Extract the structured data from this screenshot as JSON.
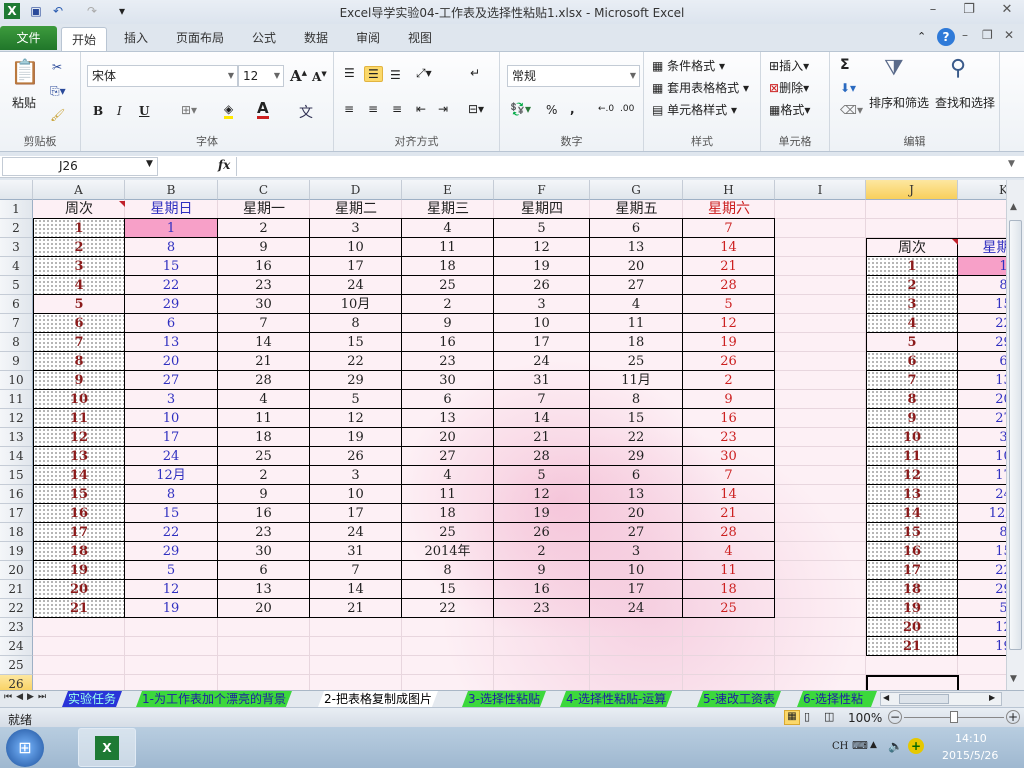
{
  "window": {
    "title": "Excel导学实验04-工作表及选择性粘贴1.xlsx  -  Microsoft Excel"
  },
  "ribbon_tabs": [
    "文件",
    "开始",
    "插入",
    "页面布局",
    "公式",
    "数据",
    "审阅",
    "视图"
  ],
  "ribbon": {
    "clipboard": {
      "label": "剪贴板",
      "paste": "粘贴"
    },
    "font": {
      "label": "字体",
      "name": "宋体",
      "size": "12",
      "bold": "B",
      "italic": "I",
      "underline": "U"
    },
    "alignment": {
      "label": "对齐方式"
    },
    "number": {
      "label": "数字",
      "format": "常规",
      "percent": "%",
      "comma": ","
    },
    "styles": {
      "label": "样式",
      "conditional": "条件格式",
      "table": "套用表格格式",
      "cell": "单元格样式"
    },
    "cells": {
      "label": "单元格",
      "insert": "插入",
      "delete": "删除",
      "format": "格式"
    },
    "editing": {
      "label": "编辑",
      "sum": "Σ",
      "sort": "排序和筛选",
      "find": "查找和选择"
    }
  },
  "formula_bar": {
    "name_box": "J26",
    "fx": "fx",
    "value": ""
  },
  "columns": [
    "A",
    "B",
    "C",
    "D",
    "E",
    "F",
    "G",
    "H",
    "I",
    "J",
    "K"
  ],
  "rows": [
    "1",
    "2",
    "3",
    "4",
    "5",
    "6",
    "7",
    "8",
    "9",
    "10",
    "11",
    "12",
    "13",
    "14",
    "15",
    "16",
    "17",
    "18",
    "19",
    "20",
    "21",
    "22",
    "23",
    "24",
    "25",
    "26"
  ],
  "selected_cell": "J26",
  "table": {
    "headers": [
      "周次",
      "星期日",
      "星期一",
      "星期二",
      "星期三",
      "星期四",
      "星期五",
      "星期六"
    ],
    "rows": [
      [
        "1",
        "1",
        "2",
        "3",
        "4",
        "5",
        "6",
        "7"
      ],
      [
        "2",
        "8",
        "9",
        "10",
        "11",
        "12",
        "13",
        "14"
      ],
      [
        "3",
        "15",
        "16",
        "17",
        "18",
        "19",
        "20",
        "21"
      ],
      [
        "4",
        "22",
        "23",
        "24",
        "25",
        "26",
        "27",
        "28"
      ],
      [
        "5",
        "29",
        "30",
        "10月",
        "2",
        "3",
        "4",
        "5"
      ],
      [
        "6",
        "6",
        "7",
        "8",
        "9",
        "10",
        "11",
        "12"
      ],
      [
        "7",
        "13",
        "14",
        "15",
        "16",
        "17",
        "18",
        "19"
      ],
      [
        "8",
        "20",
        "21",
        "22",
        "23",
        "24",
        "25",
        "26"
      ],
      [
        "9",
        "27",
        "28",
        "29",
        "30",
        "31",
        "11月",
        "2"
      ],
      [
        "10",
        "3",
        "4",
        "5",
        "6",
        "7",
        "8",
        "9"
      ],
      [
        "11",
        "10",
        "11",
        "12",
        "13",
        "14",
        "15",
        "16"
      ],
      [
        "12",
        "17",
        "18",
        "19",
        "20",
        "21",
        "22",
        "23"
      ],
      [
        "13",
        "24",
        "25",
        "26",
        "27",
        "28",
        "29",
        "30"
      ],
      [
        "14",
        "12月",
        "2",
        "3",
        "4",
        "5",
        "6",
        "7"
      ],
      [
        "15",
        "8",
        "9",
        "10",
        "11",
        "12",
        "13",
        "14"
      ],
      [
        "16",
        "15",
        "16",
        "17",
        "18",
        "19",
        "20",
        "21"
      ],
      [
        "17",
        "22",
        "23",
        "24",
        "25",
        "26",
        "27",
        "28"
      ],
      [
        "18",
        "29",
        "30",
        "31",
        "2014年",
        "2",
        "3",
        "4"
      ],
      [
        "19",
        "5",
        "6",
        "7",
        "8",
        "9",
        "10",
        "11"
      ],
      [
        "20",
        "12",
        "13",
        "14",
        "15",
        "16",
        "17",
        "18"
      ],
      [
        "21",
        "19",
        "20",
        "21",
        "22",
        "23",
        "24",
        "25"
      ]
    ]
  },
  "sheet_tabs": [
    "实验任务",
    "1-为工作表加个漂亮的背景",
    "2-把表格复制成图片",
    "3-选择性粘贴",
    "4-选择性粘贴-运算",
    "5-速改工资表",
    "6-选择性粘"
  ],
  "active_sheet": "2-把表格复制成图片",
  "status": {
    "mode": "就绪",
    "zoom": "100%"
  },
  "taskbar": {
    "lang": "CH",
    "time": "14:10",
    "date": "2015/5/26"
  },
  "colors": {
    "file_tab": "#2a8a2f",
    "sheet_tab": "#3cd83c",
    "week_number": "#8b1a1a",
    "sunday": "#3030c0",
    "saturday": "#cc2020",
    "highlight": "#f7a0c8"
  }
}
